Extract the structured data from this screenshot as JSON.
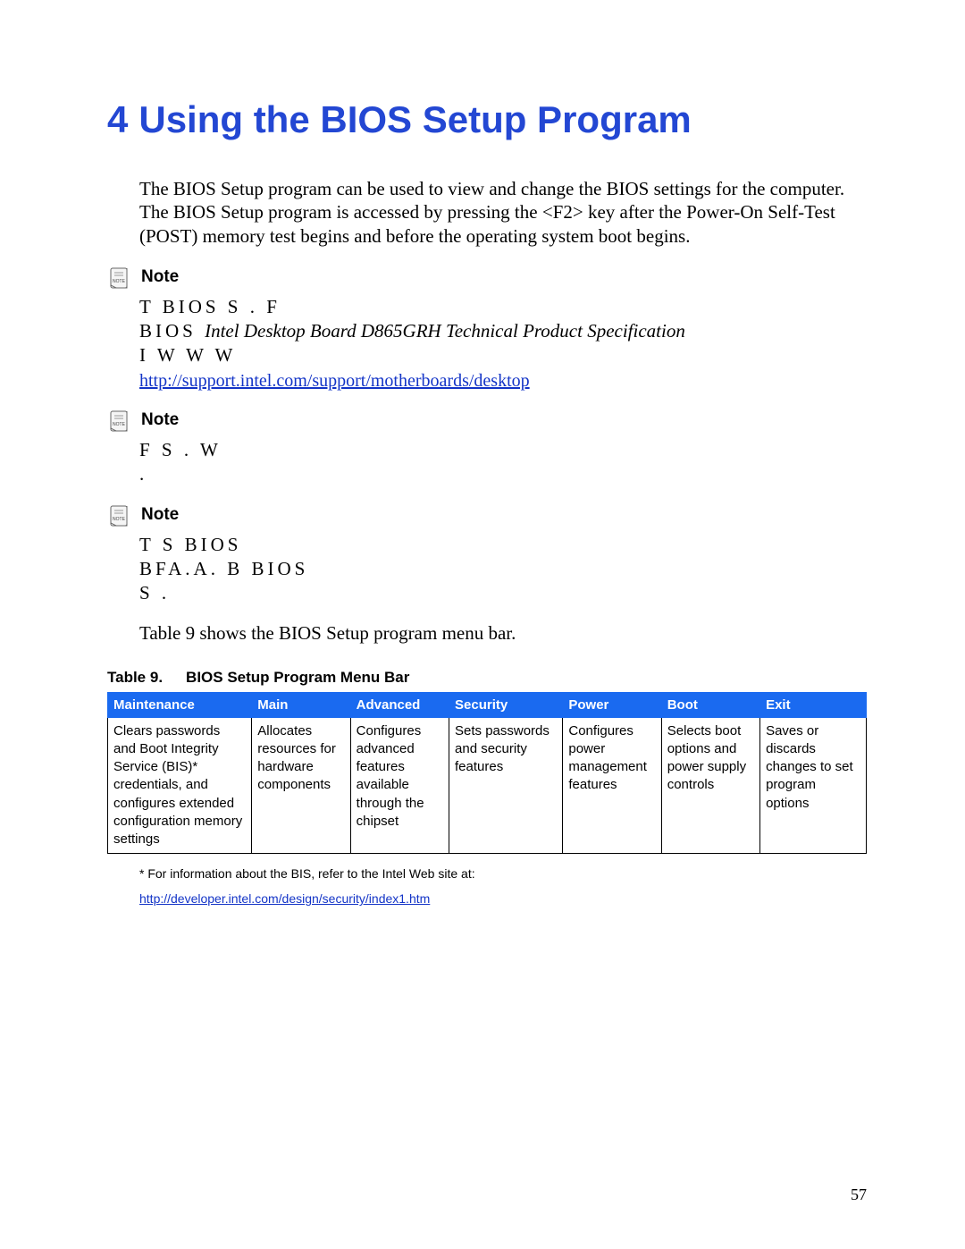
{
  "chapter": {
    "number": "4",
    "title": "Using the BIOS Setup Program"
  },
  "intro": "The BIOS Setup program can be used to view and change the BIOS settings for the computer.  The BIOS Setup program is accessed by pressing the <F2> key after the Power-On Self-Test (POST) memory test begins and before the operating system boot begins.",
  "notes": [
    {
      "heading": "Note",
      "line1": "T BIOS S        .  F",
      "line2_prefix": "BIOS                        ",
      "line2_italic": "Intel   Desktop Board D865GRH Technical Product Specification",
      "line3": "I W W W",
      "link": "http://support.intel.com/support/motherboards/desktop"
    },
    {
      "heading": "Note",
      "line1": "F      S .  W",
      "line2": "  ."
    },
    {
      "heading": "Note",
      "line1": "T S          BIOS",
      "line2": "BFA.A.  B   BIOS",
      "line3": "S ."
    }
  ],
  "table_intro": "Table 9 shows the BIOS Setup program menu bar.",
  "table": {
    "label": "Table 9.",
    "caption": "BIOS Setup Program Menu Bar",
    "headers": [
      "Maintenance",
      "Main",
      "Advanced",
      "Security",
      "Power",
      "Boot",
      "Exit"
    ],
    "cells": [
      "Clears passwords and Boot Integrity Service (BIS)* credentials, and configures extended configuration memory settings",
      "Allocates resources for hardware components",
      "Configures advanced features available through the chipset",
      "Sets passwords and security features",
      "Configures power management features",
      "Selects boot options and power supply controls",
      "Saves or discards changes to set program options"
    ]
  },
  "footnote": "*  For information about the BIS, refer to the Intel Web site at:",
  "footnote_link": "http://developer.intel.com/design/security/index1.htm",
  "page_number": "57"
}
